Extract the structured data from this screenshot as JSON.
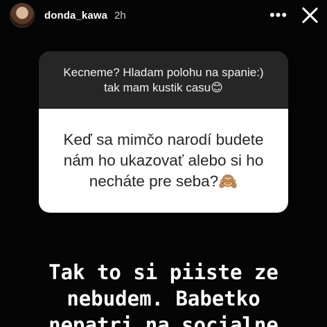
{
  "header": {
    "username": "donda_kawa",
    "time": "2h",
    "more_icon": "•••"
  },
  "question": {
    "prompt": "Kecneme? Hladam polohu na spanie:) tak mam kustik casu",
    "prompt_emoji": "😊",
    "text": "Keď sa mimčo narodí budete nám ho ukazovať alebo si ho necháte pre seba?",
    "text_emoji": "🙈"
  },
  "answer": {
    "lines": [
      "Tak to si piiste ze",
      "nebudem. Babetko",
      "nepatri na socialne"
    ]
  }
}
